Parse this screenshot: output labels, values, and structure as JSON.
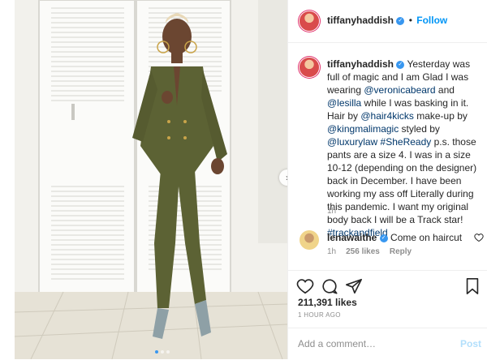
{
  "header": {
    "username": "tiffanyhaddish",
    "separator": "•",
    "follow_label": "Follow"
  },
  "caption": {
    "username": "tiffanyhaddish",
    "parts": [
      {
        "t": "text",
        "v": " Yesterday was full of magic and I am Glad I was wearing "
      },
      {
        "t": "mention",
        "v": "@veronicabeard"
      },
      {
        "t": "text",
        "v": " and "
      },
      {
        "t": "mention",
        "v": "@lesilla"
      },
      {
        "t": "text",
        "v": " while I was basking in it. Hair by "
      },
      {
        "t": "mention",
        "v": "@hair4kicks"
      },
      {
        "t": "text",
        "v": " make-up by "
      },
      {
        "t": "mention",
        "v": "@kingmalimagic"
      },
      {
        "t": "text",
        "v": " styled by "
      },
      {
        "t": "mention",
        "v": "@luxurylaw"
      },
      {
        "t": "text",
        "v": " "
      },
      {
        "t": "mention",
        "v": "#SheReady"
      },
      {
        "t": "text",
        "v": " p.s. those pants are a size 4. I was in a size 10-12 (depending on the designer) back in December. I have been working my ass off Literally during this pandemic. I want my original body back I will be a Track star! "
      },
      {
        "t": "mention",
        "v": "#trackandfield"
      }
    ],
    "time_ago": "1h"
  },
  "comment": {
    "username": "lenawaithe",
    "text": "Come on haircut",
    "time_ago": "1h",
    "likes_label": "256 likes",
    "reply_label": "Reply"
  },
  "stats": {
    "likes": "211,391 likes",
    "posted": "1 HOUR AGO"
  },
  "add_comment": {
    "placeholder": "Add a comment…",
    "post_label": "Post"
  },
  "icons": {
    "like": "heart-icon",
    "comment": "comment-icon",
    "share": "share-icon",
    "save": "bookmark-icon",
    "next": "chevron-right-icon"
  },
  "colors": {
    "accent": "#0095f6",
    "post_disabled": "#b2dffc",
    "verified": "#3897f0"
  }
}
